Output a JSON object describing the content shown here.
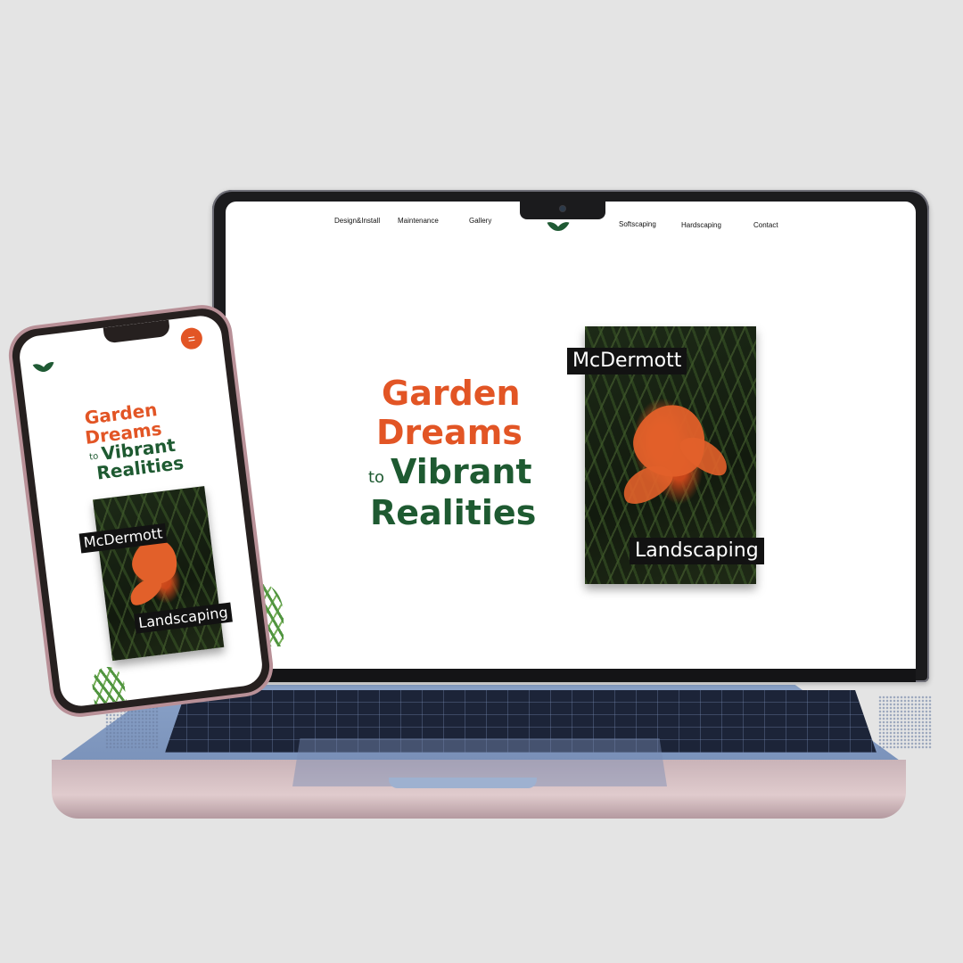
{
  "laptop": {
    "nav": {
      "items": [
        "Design&Install",
        "Maintenance",
        "Gallery",
        "Softscaping",
        "Hardscaping",
        "Contact"
      ]
    },
    "hero": {
      "line1": "Garden",
      "line2": "Dreams",
      "connector": "to",
      "line3": "Vibrant",
      "line4": "Realities"
    },
    "photo_card": {
      "label_top": "McDermott",
      "label_bottom": "Landscaping"
    }
  },
  "phone": {
    "menu_icon": "menu-icon",
    "hero": {
      "line1": "Garden",
      "line2": "Dreams",
      "connector": "to",
      "line3": "Vibrant",
      "line4": "Realities"
    },
    "photo_card": {
      "label_top": "McDermott",
      "label_bottom": "Landscaping"
    }
  },
  "colors": {
    "accent_orange": "#e25525",
    "brand_green": "#1e5a31",
    "background": "#e4e4e4"
  },
  "icons": [
    "leaf-logo-icon",
    "menu-icon",
    "camera-icon"
  ]
}
